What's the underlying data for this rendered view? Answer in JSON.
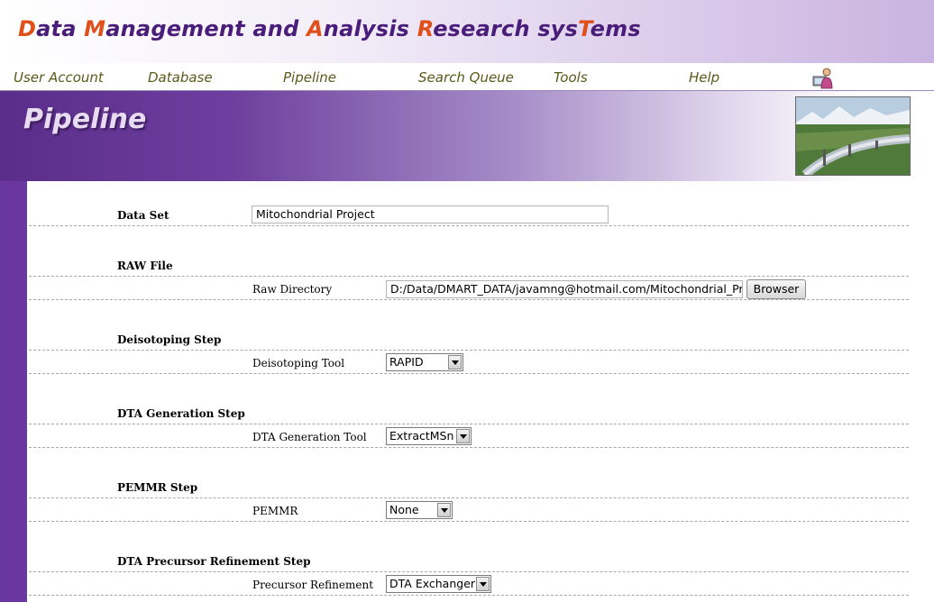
{
  "app": {
    "title_segments": [
      {
        "text": "D",
        "cap": true
      },
      {
        "text": "ata ",
        "cap": false
      },
      {
        "text": "M",
        "cap": true
      },
      {
        "text": "anagement and ",
        "cap": false
      },
      {
        "text": "A",
        "cap": true
      },
      {
        "text": "nalysis ",
        "cap": false
      },
      {
        "text": "R",
        "cap": true
      },
      {
        "text": "esearch sys",
        "cap": false
      },
      {
        "text": "T",
        "cap": true
      },
      {
        "text": "ems",
        "cap": false
      }
    ]
  },
  "nav": {
    "user_account": "User Account",
    "database": "Database",
    "pipeline": "Pipeline",
    "search_queue": "Search Queue",
    "tools": "Tools",
    "help": "Help"
  },
  "banner": {
    "title": "Pipeline"
  },
  "form": {
    "data_set": {
      "label": "Data Set",
      "value": "Mitochondrial Project"
    },
    "raw_file": {
      "section": "RAW File",
      "dir_label": "Raw Directory",
      "dir_value": "D:/Data/DMART_DATA/javamng@hotmail.com/Mitochondrial_Project",
      "browse_label": "Browser"
    },
    "deisotoping": {
      "section": "Deisotoping Step",
      "label": "Deisotoping Tool",
      "value": "RAPID"
    },
    "dta_generation": {
      "section": "DTA Generation Step",
      "label": "DTA Generation Tool",
      "value": "ExtractMSn"
    },
    "pemmr": {
      "section": "PEMMR Step",
      "label": "PEMMR",
      "value": "None"
    },
    "precursor": {
      "section": "DTA Precursor Refinement Step",
      "label": "Precursor Refinement",
      "value": "DTA Exchanger"
    }
  },
  "colors": {
    "brand_purple": "#4a1d7a",
    "accent_orange": "#e0501a",
    "nav_text": "#5a5a1a",
    "strip": "#6a37a0"
  }
}
